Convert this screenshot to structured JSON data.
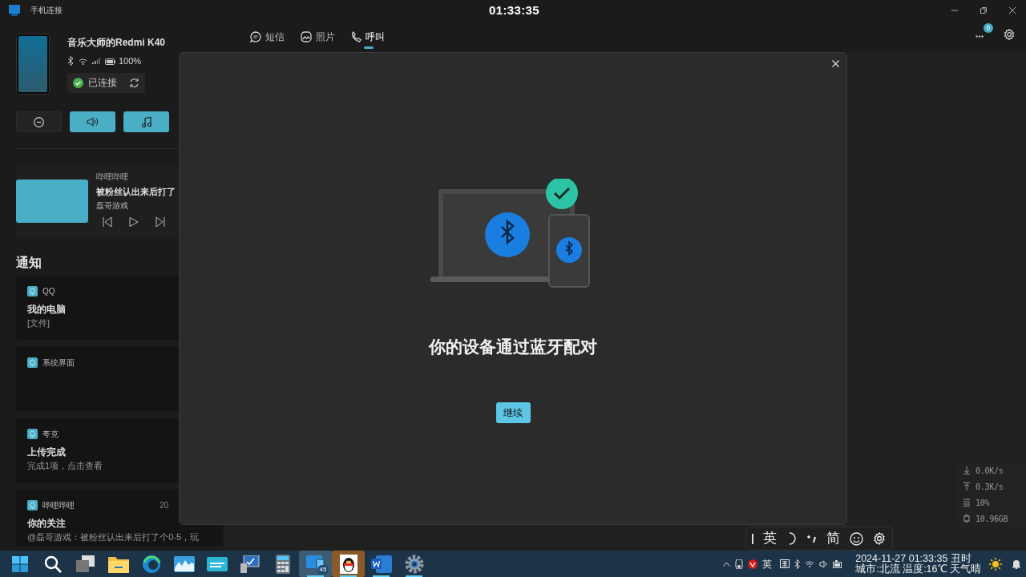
{
  "window": {
    "title": "手机连接",
    "clock": "01:33:35"
  },
  "device": {
    "name": "音乐大师的Redmi K40",
    "battery": "100%",
    "status": "已连接"
  },
  "quick_toggles": [
    {
      "kind": "dnd",
      "on": false
    },
    {
      "kind": "volume",
      "on": true
    },
    {
      "kind": "music",
      "on": true
    }
  ],
  "media": {
    "app": "哔哩哔哩",
    "title": "被粉丝认出来后打了",
    "artist": "磊哥游戏"
  },
  "notifications": {
    "heading": "通知",
    "items": [
      {
        "app": "QQ",
        "title": "我的电脑",
        "body": "[文件]"
      },
      {
        "app": "系统界面"
      },
      {
        "app": "夸克",
        "title": "上传完成",
        "body": "完成1项，点击查看"
      },
      {
        "app": "哔哩哔哩",
        "time": "20",
        "title": "你的关注",
        "body": "@磊哥游戏：被粉丝认出来后打了个0-5，玩"
      }
    ]
  },
  "tabs": [
    {
      "kind": "message",
      "label": "短信",
      "selected": false
    },
    {
      "kind": "photo",
      "label": "照片",
      "selected": false
    },
    {
      "kind": "call",
      "label": "呼叫",
      "selected": true
    }
  ],
  "more": {
    "badge": "6"
  },
  "dialog": {
    "heading": "你的设备通过蓝牙配对",
    "button": "继续"
  },
  "ime_toolbar": [
    {
      "kind": "text",
      "label": "英"
    },
    {
      "kind": "moon"
    },
    {
      "kind": "punct"
    },
    {
      "kind": "text",
      "label": "简"
    },
    {
      "kind": "emoji"
    },
    {
      "kind": "gear"
    }
  ],
  "net_monitor": [
    {
      "kind": "down",
      "value": "0.0K/s"
    },
    {
      "kind": "up",
      "value": "0.3K/s"
    },
    {
      "kind": "cpu",
      "value": "10%"
    },
    {
      "kind": "mem",
      "value": "10.96GB"
    }
  ],
  "taskbar": {
    "apps": [
      {
        "kind": "start",
        "selected": false,
        "flashing": false,
        "running": false
      },
      {
        "kind": "search",
        "selected": false,
        "flashing": false,
        "running": false
      },
      {
        "kind": "taskview",
        "selected": false,
        "flashing": false,
        "running": false
      },
      {
        "kind": "folder",
        "selected": false,
        "flashing": false,
        "running": false
      },
      {
        "kind": "edge",
        "selected": false,
        "flashing": false,
        "running": false
      },
      {
        "kind": "monitor",
        "selected": false,
        "flashing": false,
        "running": false
      },
      {
        "kind": "keyboard",
        "selected": false,
        "flashing": false,
        "running": false
      },
      {
        "kind": "computer",
        "selected": false,
        "flashing": false,
        "running": false
      },
      {
        "kind": "calculator",
        "selected": false,
        "flashing": false,
        "running": false
      },
      {
        "kind": "phonelink",
        "selected": true,
        "flashing": false,
        "running": true,
        "badge": "45"
      },
      {
        "kind": "qq",
        "selected": false,
        "flashing": true,
        "running": true
      },
      {
        "kind": "word",
        "selected": false,
        "flashing": false,
        "running": true
      },
      {
        "kind": "settings",
        "selected": false,
        "flashing": false,
        "running": true
      }
    ],
    "tray": {
      "ime": "英",
      "date": "2024-11-27 01:33:35 丑时",
      "weather": "城市:北流 温度:16℃ 天气晴"
    }
  }
}
